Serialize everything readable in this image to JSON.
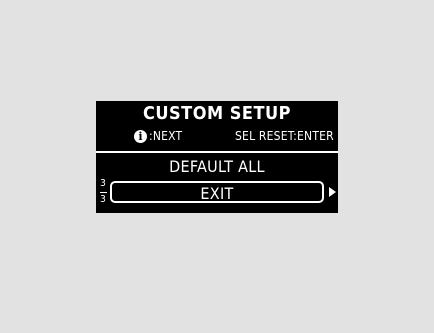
{
  "screen": {
    "title": "CUSTOM SETUP",
    "hints": {
      "info_icon_glyph": "i",
      "next_label": ":NEXT",
      "reset_label": "SEL RESET:ENTER"
    },
    "menu": {
      "items": [
        {
          "label": "DEFAULT ALL",
          "selected": false
        },
        {
          "label": "EXIT",
          "selected": true
        }
      ]
    },
    "page": {
      "current": "3",
      "total": "3"
    },
    "icons": {
      "info": "info-icon",
      "more": "arrow-right-icon"
    }
  }
}
